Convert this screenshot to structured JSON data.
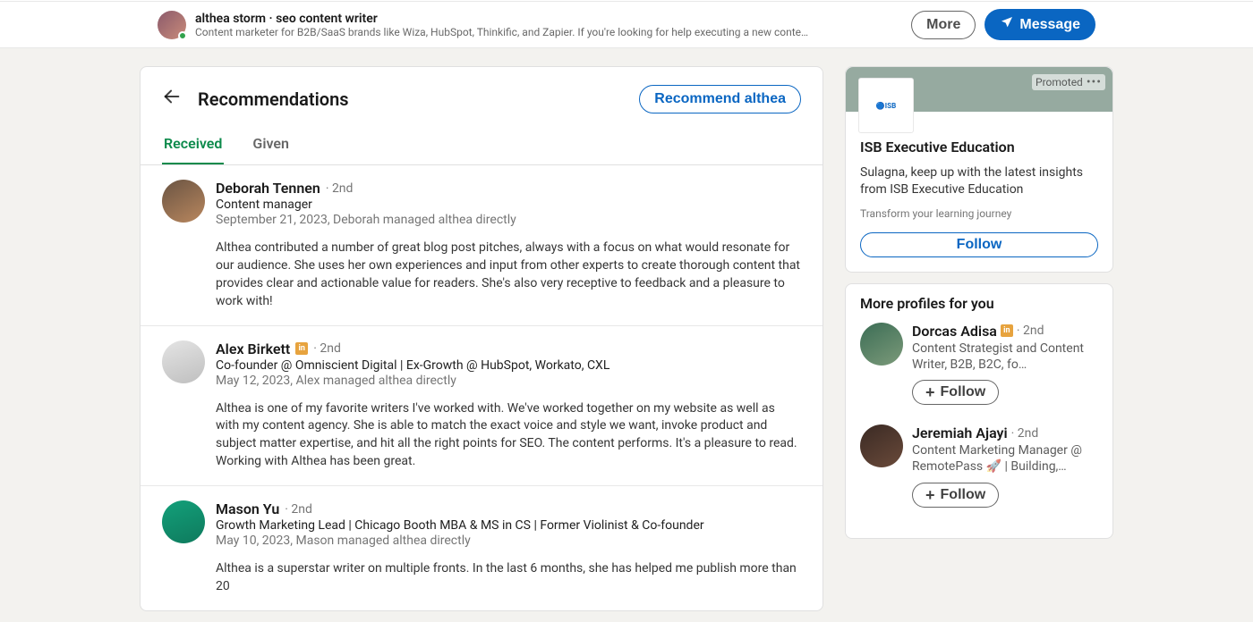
{
  "header": {
    "name_line": "althea storm · seo content writer",
    "headline": "Content marketer for B2B/SaaS brands like Wiza, HubSpot, Thinkific, and Zapier. If you're looking for help executing a new conte…",
    "more_label": "More",
    "message_label": "Message"
  },
  "recommendations": {
    "title": "Recommendations",
    "recommend_button": "Recommend althea",
    "tabs": {
      "received": "Received",
      "given": "Given"
    },
    "items": [
      {
        "name": "Deborah Tennen",
        "degree": "· 2nd",
        "role": "Content manager",
        "date": "September 21, 2023, Deborah managed althea directly",
        "text": "Althea contributed a number of great blog post pitches, always with a focus on what would resonate for our audience. She uses her own experiences and input from other experts to create thorough content that provides clear and actionable value for readers. She's also very receptive to feedback and a pleasure to work with!",
        "avatar_bg": "linear-gradient(150deg,#6a5443,#b9875e)",
        "premium": false
      },
      {
        "name": "Alex Birkett",
        "degree": "· 2nd",
        "role": "Co-founder @ Omniscient Digital | Ex-Growth @ HubSpot, Workato, CXL",
        "date": "May 12, 2023, Alex managed althea directly",
        "text": "Althea is one of my favorite writers I've worked with. We've worked together on my website as well as with my content agency. She is able to match the exact voice and style we want, invoke product and subject matter expertise, and hit all the right points for SEO. The content performs. It's a pleasure to read. Working with Althea has been great.",
        "avatar_bg": "linear-gradient(160deg,#e4e4e4,#bfbfbf)",
        "premium": true
      },
      {
        "name": "Mason Yu",
        "degree": "· 2nd",
        "role": "Growth Marketing Lead | Chicago Booth MBA & MS in CS | Former Violinist & Co-founder",
        "date": "May 10, 2023, Mason managed althea directly",
        "text": "Althea is a superstar writer on multiple fronts. In the last 6 months, she has helped me publish more than 20",
        "avatar_bg": "linear-gradient(160deg,#13a07a,#0e7a5d)",
        "premium": false
      }
    ]
  },
  "promoted": {
    "label": "Promoted",
    "logo_text": "ISB",
    "title": "ISB Executive Education",
    "text": "Sulagna, keep up with the latest insights from ISB Executive Education",
    "subtext": "Transform your learning journey",
    "follow_label": "Follow"
  },
  "more_profiles": {
    "heading": "More profiles for you",
    "follow_label": "Follow",
    "items": [
      {
        "name": "Dorcas Adisa",
        "degree": "· 2nd",
        "headline": "Content Strategist and Content Writer, B2B, B2C, fo…",
        "avatar_bg": "linear-gradient(150deg,#3b6d55,#7c9a7a)",
        "premium": true
      },
      {
        "name": "Jeremiah Ajayi",
        "degree": "· 2nd",
        "headline": "Content Marketing Manager @ RemotePass 🚀 | Building,…",
        "avatar_bg": "linear-gradient(150deg,#3a2a24,#6a4a3a)",
        "premium": false
      }
    ]
  }
}
